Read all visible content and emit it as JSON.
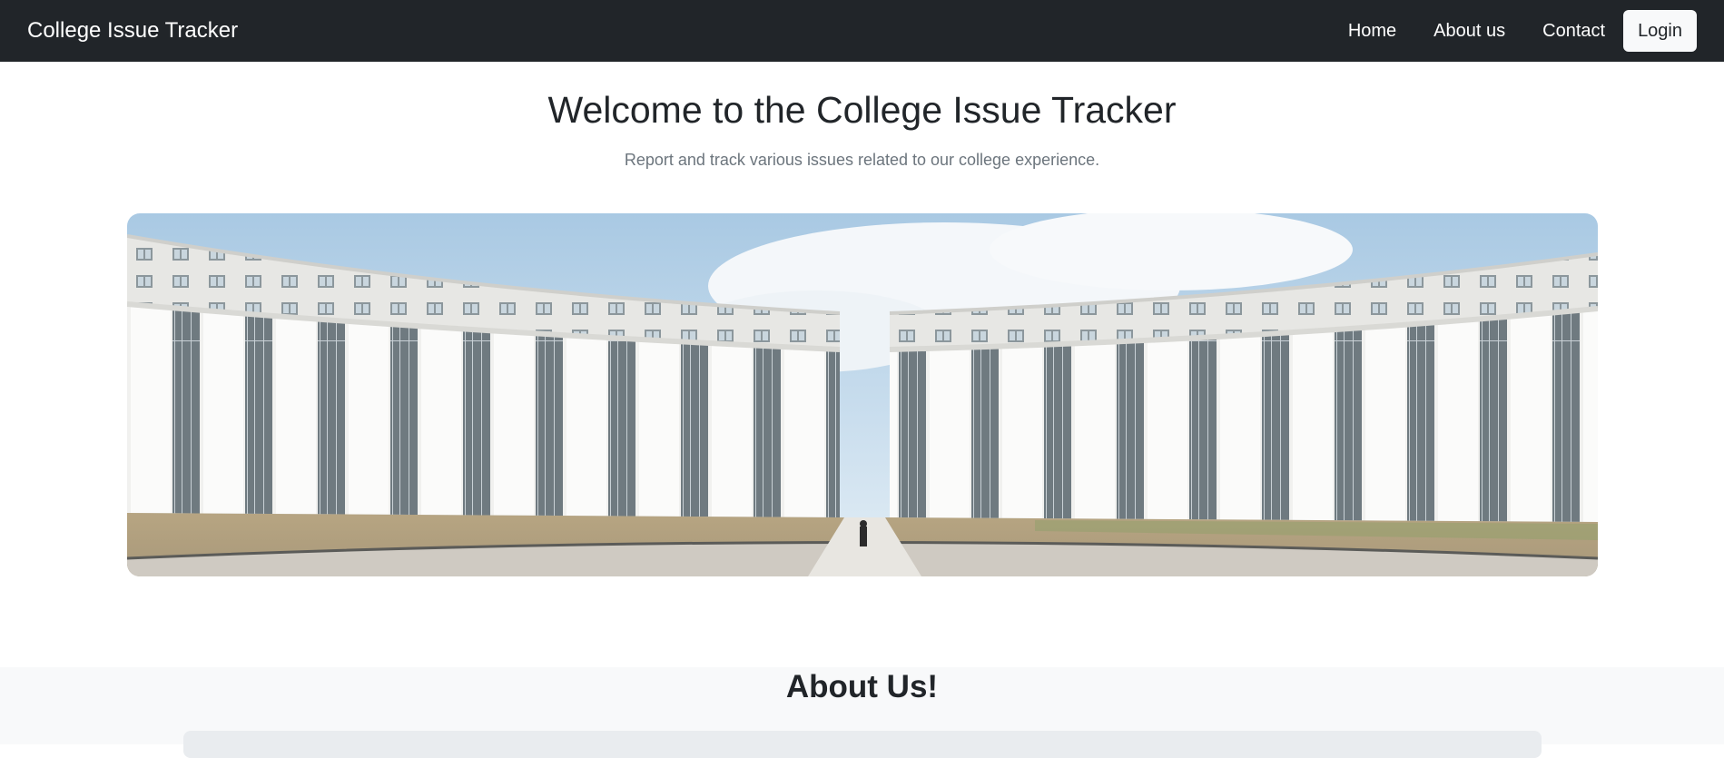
{
  "navbar": {
    "brand": "College Issue Tracker",
    "links": [
      "Home",
      "About us",
      "Contact"
    ],
    "login_label": "Login"
  },
  "hero": {
    "title": "Welcome to the College Issue Tracker",
    "subtitle": "Report and track various issues related to our college experience."
  },
  "about": {
    "title": "About Us!"
  },
  "colors": {
    "navbar_bg": "#212529",
    "subtitle": "#6c757d",
    "about_bg": "#f8f9fa"
  }
}
